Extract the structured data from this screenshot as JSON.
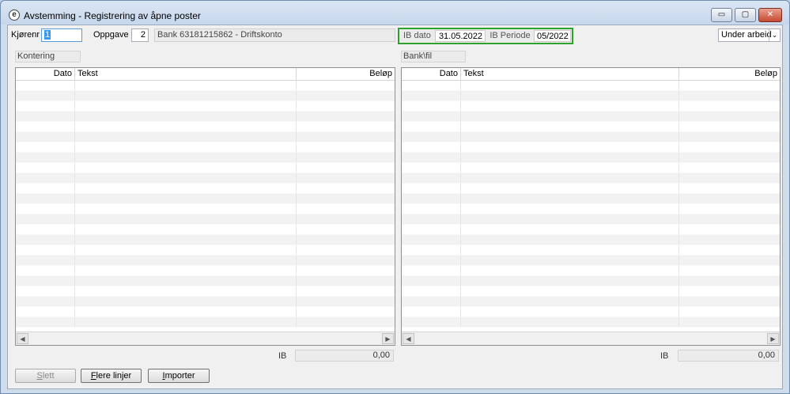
{
  "window": {
    "title": "Avstemming - Registrering av åpne poster",
    "app_icon_glyph": "e",
    "minimize_glyph": "▭",
    "maximize_glyph": "▢",
    "close_glyph": "✕"
  },
  "header": {
    "kjorenr_label": "Kjørenr",
    "kjorenr_value": "1",
    "oppgave_label": "Oppgave",
    "oppgave_value": "2",
    "account_text": "Bank 63181215862 - Driftskonto",
    "ib_dato_label": "IB dato",
    "ib_dato_value": "31.05.2022",
    "ib_periode_label": "IB Periode",
    "ib_periode_value": "05/2022",
    "status_value": "Under arbeid",
    "status_arrow": "⌄"
  },
  "left_panel": {
    "section_label": "Kontering",
    "columns": [
      "Dato",
      "Tekst",
      "Beløp"
    ],
    "ib_label": "IB",
    "ib_value": "0,00",
    "scroll_left": "◀",
    "scroll_right": "▶"
  },
  "right_panel": {
    "section_label": "Bank\\fil",
    "columns": [
      "Dato",
      "Tekst",
      "Beløp"
    ],
    "ib_label": "IB",
    "ib_value": "0,00",
    "scroll_left": "◀",
    "scroll_right": "▶"
  },
  "buttons": {
    "slett_first": "S",
    "slett_rest": "lett",
    "flere_first": "F",
    "flere_rest": "lere linjer",
    "importer_first": "I",
    "importer_rest": "mporter"
  },
  "colors": {
    "ib_highlight": "#2ea12e",
    "selection": "#3399ff",
    "close_button": "#c74a32"
  }
}
